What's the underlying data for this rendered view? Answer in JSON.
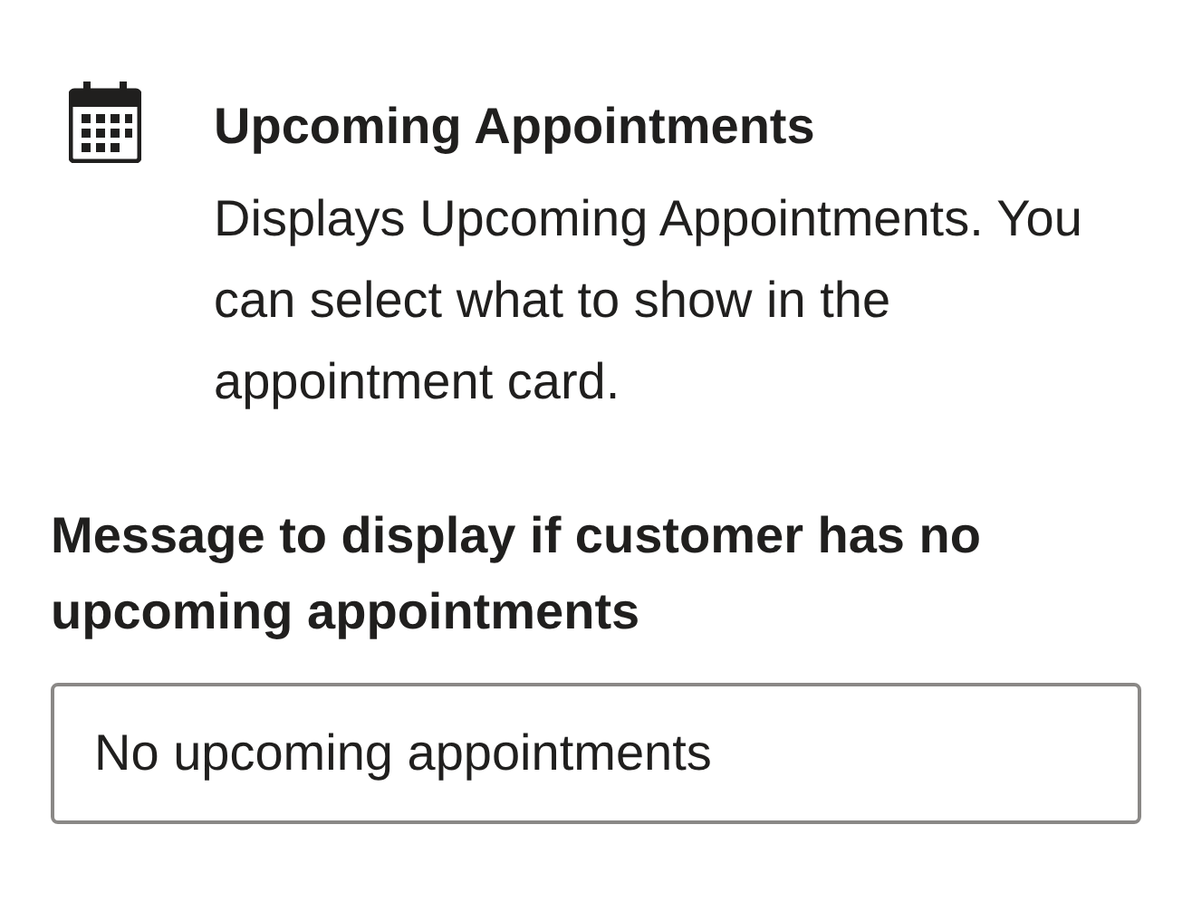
{
  "widget": {
    "title": "Upcoming Appointments",
    "description": "Displays Upcoming Appointments. You can select what to show in the appointment card."
  },
  "message_field": {
    "label": "Message to display if customer has no upcoming appointments",
    "value": "No upcoming appointments"
  }
}
